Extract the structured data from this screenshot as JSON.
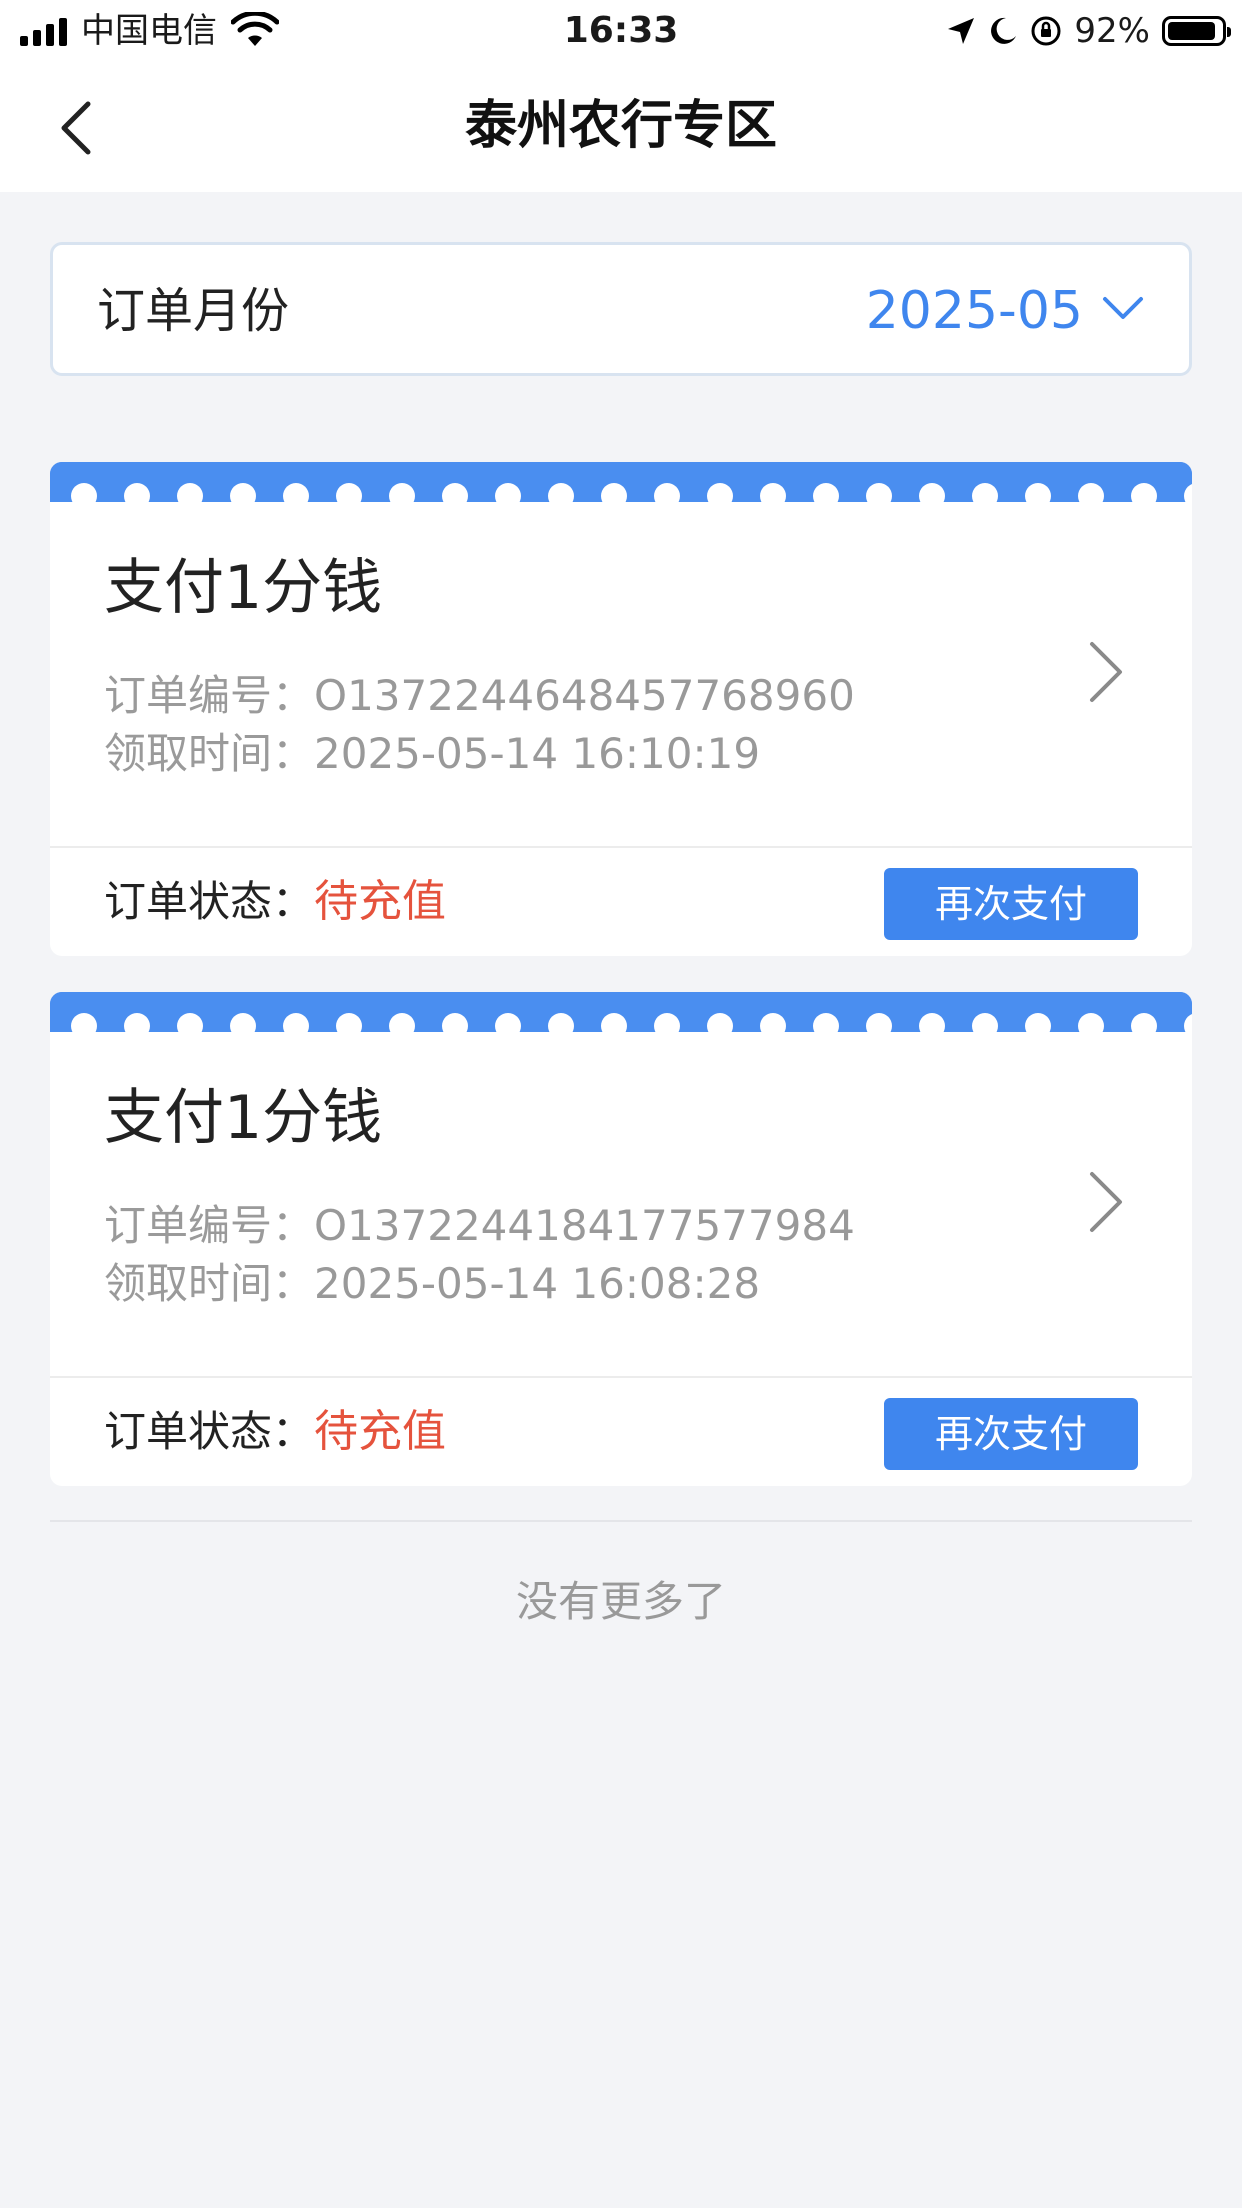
{
  "status_bar": {
    "carrier": "中国电信",
    "time": "16:33",
    "battery_text": "92%",
    "battery_level": 0.92,
    "icons": [
      "signal-icon",
      "wifi-icon",
      "location-icon",
      "moon-icon",
      "rotation-lock-icon",
      "battery-icon"
    ]
  },
  "nav": {
    "title": "泰州农行专区",
    "back_icon": "chevron-left-icon"
  },
  "month_picker": {
    "label": "订单月份",
    "value": "2025-05",
    "icon": "chevron-down-icon"
  },
  "orders": [
    {
      "title": "支付1分钱",
      "order_no_label": "订单编号：",
      "order_no": "O1372244648457768960",
      "time_label": "领取时间：",
      "time": "2025-05-14 16:10:19",
      "status_label": "订单状态：",
      "status": "待充值",
      "button": "再次支付"
    },
    {
      "title": "支付1分钱",
      "order_no_label": "订单编号：",
      "order_no": "O1372244184177577984",
      "time_label": "领取时间：",
      "time": "2025-05-14 16:08:28",
      "status_label": "订单状态：",
      "status": "待充值",
      "button": "再次支付"
    }
  ],
  "footer": {
    "no_more": "没有更多了"
  },
  "colors": {
    "accent": "#3f86ee",
    "card_band": "#4a8ef0",
    "status_red": "#e5533d",
    "background": "#f3f4f7"
  }
}
